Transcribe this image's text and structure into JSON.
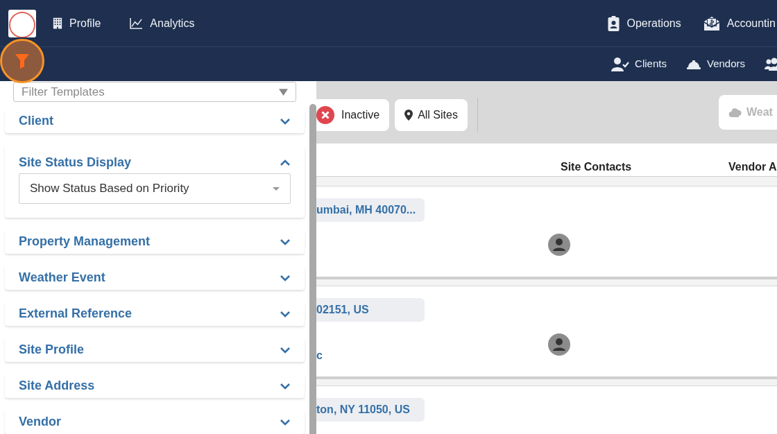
{
  "nav_primary": [
    {
      "kind": "building",
      "label": "Profile"
    },
    {
      "kind": "chart",
      "label": "Analytics"
    },
    {
      "kind": "badge",
      "label": "Operations"
    },
    {
      "kind": "money",
      "label": "Accountin"
    }
  ],
  "nav_secondary": [
    {
      "kind": "user-check",
      "label": "Clients"
    },
    {
      "kind": "helmet",
      "label": "Vendors"
    },
    {
      "kind": "users-gear"
    }
  ],
  "filter_panel": {
    "template_select": {
      "placeholder": "Filter Templates"
    },
    "sections": [
      {
        "title": "Client",
        "expanded": false
      },
      {
        "title": "Site Status Display",
        "expanded": true,
        "select": {
          "value": "Show Status Based on Priority"
        }
      },
      {
        "title": "Property Management",
        "expanded": false
      },
      {
        "title": "Weather Event",
        "expanded": false
      },
      {
        "title": "External Reference",
        "expanded": false
      },
      {
        "title": "Site Profile",
        "expanded": false
      },
      {
        "title": "Site Address",
        "expanded": false
      },
      {
        "title": "Vendor",
        "expanded": false
      }
    ]
  },
  "toolbar": {
    "chips": [
      {
        "kind": "status",
        "label": "Inactive"
      },
      {
        "kind": "location",
        "label": "All Sites"
      }
    ],
    "weather_button": {
      "label": "Weat",
      "disabled": true
    }
  },
  "table": {
    "columns": [
      "Site Contacts",
      "Vendor A"
    ],
    "rows": [
      {
        "address": "umbai, MH 40070..."
      },
      {
        "address": "02151, US",
        "column_2": "c"
      },
      {
        "address": "ton, NY 11050, US"
      }
    ]
  }
}
